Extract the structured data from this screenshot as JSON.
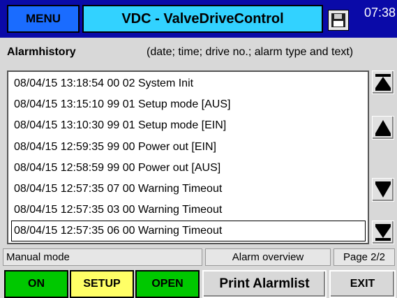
{
  "header": {
    "menu_label": "MENU",
    "title": "VDC - ValveDriveControl",
    "clock": "07:38"
  },
  "alarmhistory": {
    "title": "Alarmhistory",
    "description": "(date; time; drive no.; alarm type and text)",
    "rows": [
      "08/04/15 13:18:54  00 02 System Init",
      "08/04/15 13:15:10  99 01 Setup mode [AUS]",
      "08/04/15 13:10:30  99 01 Setup mode [EIN]",
      "08/04/15 12:59:35  99 00 Power out [EIN]",
      "08/04/15 12:58:59  99 00 Power out [AUS]",
      "08/04/15 12:57:35  07 00 Warning Timeout",
      "08/04/15 12:57:35  03 00 Warning Timeout",
      "08/04/15 12:57:35  06 00 Warning Timeout"
    ]
  },
  "statusbar": {
    "mode": "Manual mode",
    "view": "Alarm overview",
    "page": "Page 2/2"
  },
  "buttons": {
    "on": "ON",
    "setup": "SETUP",
    "open": "OPEN",
    "print": "Print Alarmlist",
    "exit": "EXIT"
  },
  "colors": {
    "topbar": "#0a0aa8",
    "menu": "#1a6cff",
    "title": "#32d2ff",
    "on": "#00c800",
    "setup": "#ffff66",
    "open": "#00c800",
    "neutral": "#d8d8d8"
  },
  "icons": {
    "save": "floppy-disk-icon",
    "scroll_top": "scroll-to-top-icon",
    "scroll_up": "scroll-up-icon",
    "scroll_down": "scroll-down-icon",
    "scroll_bottom": "scroll-to-bottom-icon"
  }
}
